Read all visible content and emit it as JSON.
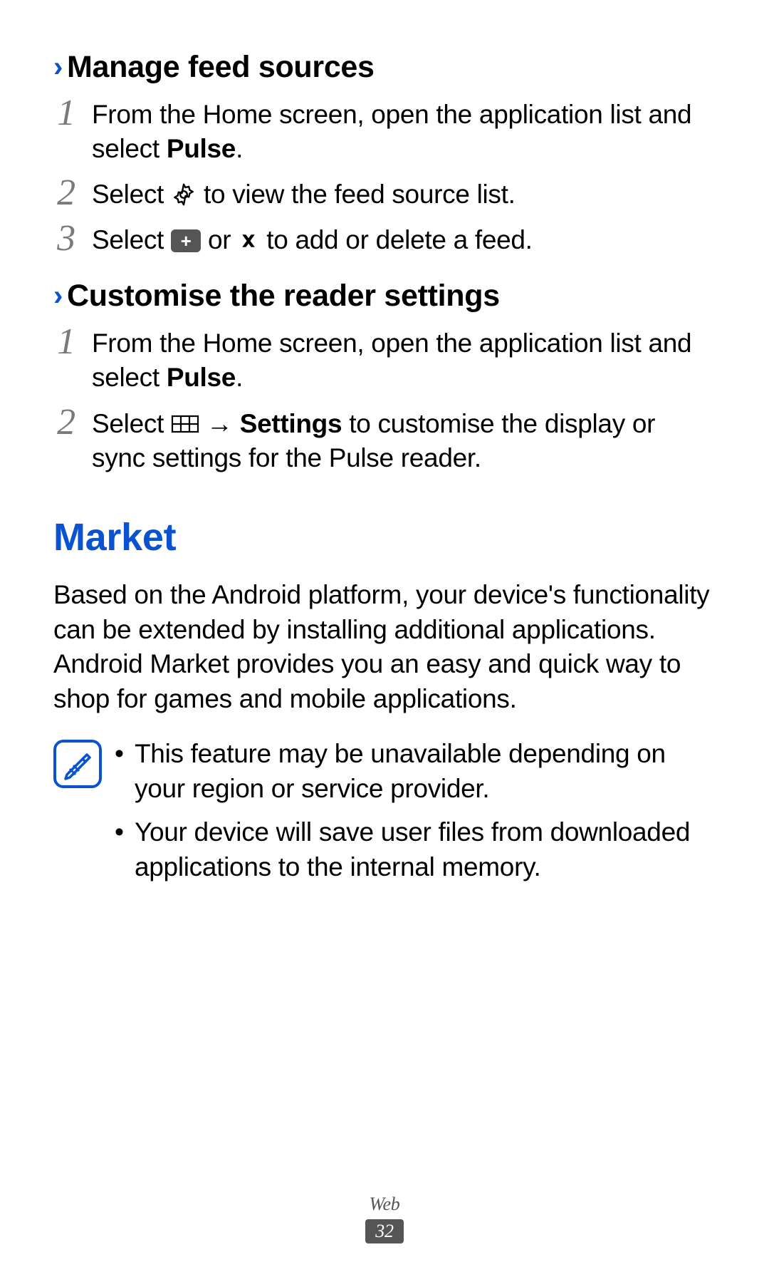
{
  "section1": {
    "heading": "Manage feed sources",
    "steps": {
      "s1": {
        "num": "1",
        "pre": "From the Home screen, open the application list and select ",
        "bold": "Pulse",
        "post": "."
      },
      "s2": {
        "num": "2",
        "pre": "Select ",
        "post": " to view the feed source list."
      },
      "s3": {
        "num": "3",
        "pre": "Select ",
        "mid": " or ",
        "post": " to add or delete a feed."
      }
    }
  },
  "section2": {
    "heading": "Customise the reader settings",
    "steps": {
      "s1": {
        "num": "1",
        "pre": "From the Home screen, open the application list and select ",
        "bold": "Pulse",
        "post": "."
      },
      "s2": {
        "num": "2",
        "pre": "Select ",
        "arrow": " → ",
        "bold": "Settings",
        "post": " to customise the display or sync settings for the Pulse reader."
      }
    }
  },
  "market": {
    "title": "Market",
    "para": "Based on the Android platform, your device's functionality can be extended by installing additional applications. Android Market provides you an easy and quick way to shop for games and mobile applications.",
    "notes": {
      "n1": "This feature may be unavailable depending on your region or service provider.",
      "n2": "Your device will save user files from downloaded applications to the internal memory."
    }
  },
  "footer": {
    "chapter": "Web",
    "page": "32"
  }
}
